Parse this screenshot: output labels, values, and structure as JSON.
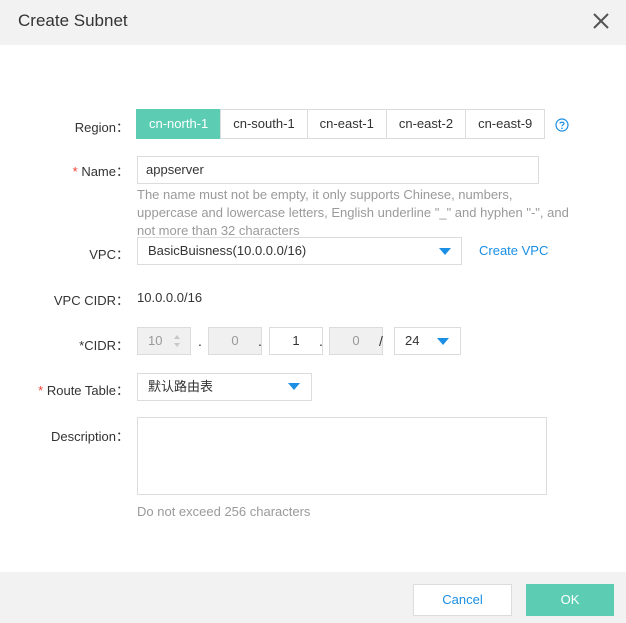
{
  "dialog": {
    "title": "Create Subnet"
  },
  "region": {
    "label": "Region：",
    "options": [
      "cn-north-1",
      "cn-south-1",
      "cn-east-1",
      "cn-east-2",
      "cn-east-9"
    ],
    "selected": "cn-north-1"
  },
  "name": {
    "required_mark": "*",
    "label": " Name：",
    "value": "appserver",
    "hint_lines": [
      "The name must not be empty, it only supports Chinese, numbers,",
      "uppercase and lowercase letters, English underline \"_\" and hyphen \"-\", and",
      "not more than 32 characters"
    ]
  },
  "vpc": {
    "label": "VPC：",
    "selected": "BasicBuisness(10.0.0.0/16)",
    "create_link": "Create VPC"
  },
  "vpc_cidr": {
    "label": "VPC CIDR：",
    "value": "10.0.0.0/16"
  },
  "cidr": {
    "label": "*CIDR：",
    "octets": [
      "10",
      "0",
      "1",
      "0"
    ],
    "dot": ".",
    "slash": "/",
    "mask": "24"
  },
  "route_table": {
    "required_mark": "*",
    "label": " Route Table：",
    "selected": "默认路由表"
  },
  "description": {
    "label": "Description：",
    "hint": "Do not exceed 256 characters"
  },
  "footer": {
    "cancel_label": "Cancel",
    "ok_label": "OK"
  },
  "colors": {
    "accent": "#5ccdb3",
    "link": "#1a8fe3",
    "required": "#f04134"
  }
}
